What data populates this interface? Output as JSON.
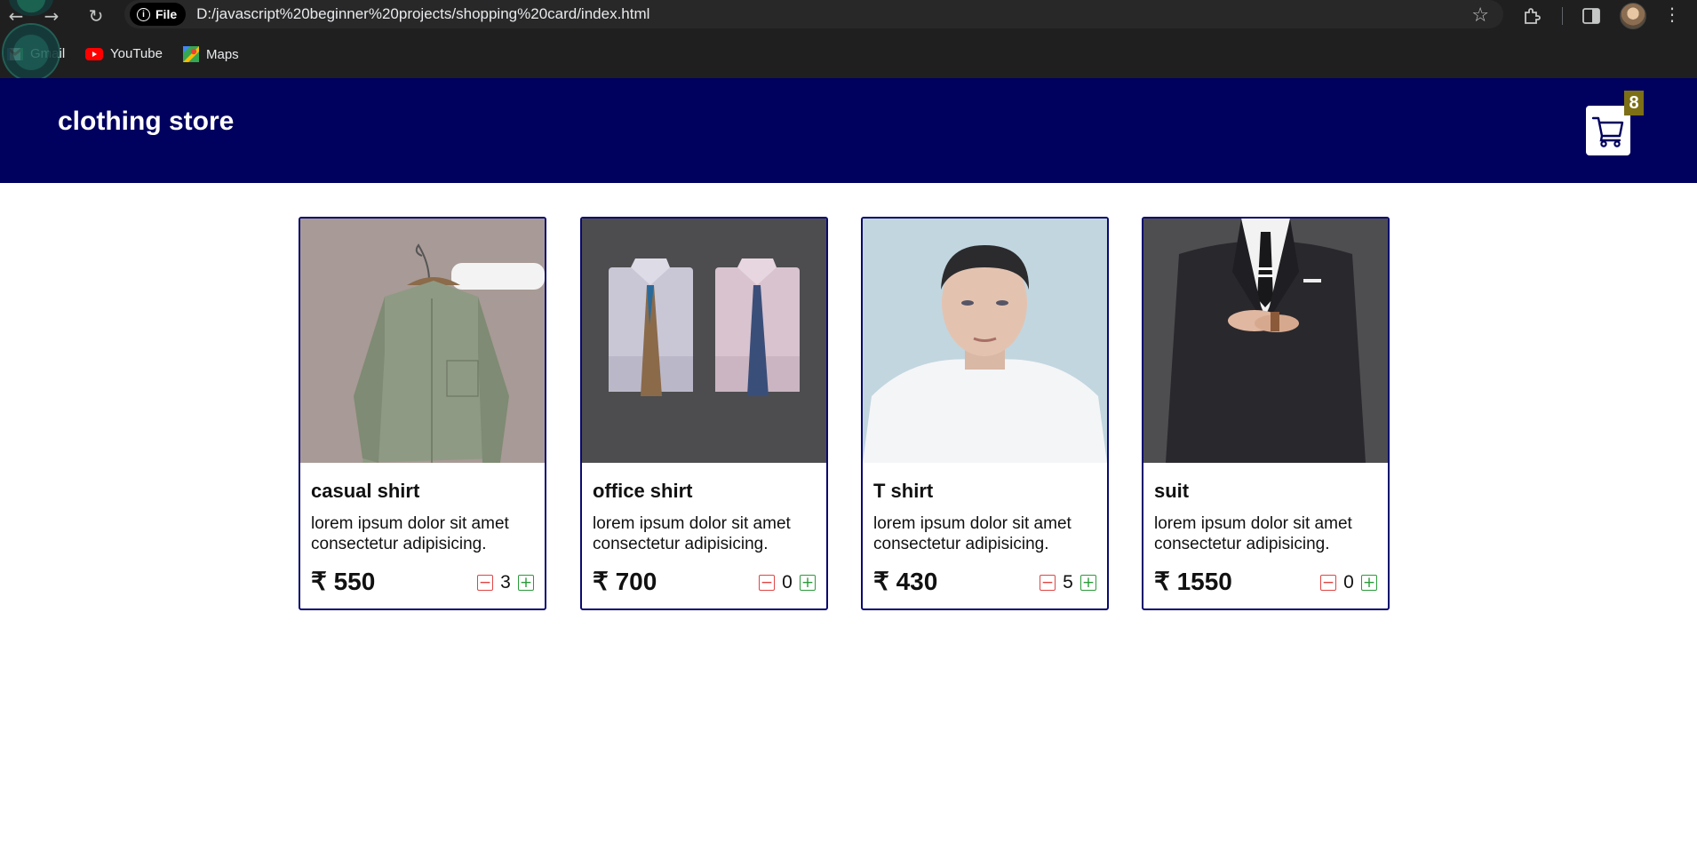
{
  "browser": {
    "file_chip": "File",
    "url": "D:/javascript%20beginner%20projects/shopping%20card/index.html",
    "bookmarks": [
      {
        "label": "Gmail",
        "icon": "gmail-icon"
      },
      {
        "label": "YouTube",
        "icon": "youtube-icon"
      },
      {
        "label": "Maps",
        "icon": "maps-icon"
      }
    ]
  },
  "header": {
    "title": "clothing store",
    "cart_count": "8",
    "colors": {
      "background": "#00005f",
      "badge": "#7c6f16"
    }
  },
  "products": [
    {
      "name": "casual shirt",
      "description": "lorem ipsum dolor sit amet consectetur adipisicing.",
      "price": "₹ 550",
      "quantity": "3",
      "image": "casual-shirt-image"
    },
    {
      "name": "office shirt",
      "description": "lorem ipsum dolor sit amet consectetur adipisicing.",
      "price": "₹ 700",
      "quantity": "0",
      "image": "office-shirt-image"
    },
    {
      "name": "T shirt",
      "description": "lorem ipsum dolor sit amet consectetur adipisicing.",
      "price": "₹ 430",
      "quantity": "5",
      "image": "t-shirt-image"
    },
    {
      "name": "suit",
      "description": "lorem ipsum dolor sit amet consectetur adipisicing.",
      "price": "₹ 1550",
      "quantity": "0",
      "image": "suit-image"
    }
  ],
  "qty_controls": {
    "minus": "−",
    "plus": "+",
    "minus_color": "#e04545",
    "plus_color": "#2a9a3a"
  }
}
